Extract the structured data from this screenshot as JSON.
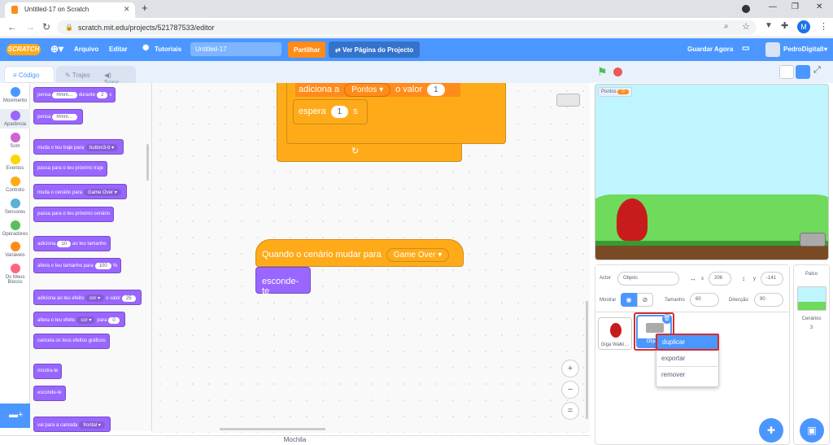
{
  "browser": {
    "tab_title": "Untitled-17 on Scratch",
    "url": "scratch.mit.edu/projects/521787533/editor",
    "profile_initial": "M"
  },
  "menu": {
    "logo": "SCRATCH",
    "file": "Arquivo",
    "edit": "Editar",
    "tutorials": "Tutoriais",
    "project_title": "Untitled-17",
    "share": "Partilhar",
    "see_project": "Ver Página do Projecto",
    "save_now": "Guardar Agora",
    "username": "PedroDigitalI"
  },
  "tabs": {
    "code": "Código",
    "costumes": "Trajes",
    "sounds": "Sons"
  },
  "categories": [
    {
      "label": "Movimento",
      "color": "#4c97ff"
    },
    {
      "label": "Aparência",
      "color": "#9966ff"
    },
    {
      "label": "Som",
      "color": "#cf63cf"
    },
    {
      "label": "Eventos",
      "color": "#ffd500"
    },
    {
      "label": "Controlo",
      "color": "#ffab19"
    },
    {
      "label": "Sensores",
      "color": "#5cb1d6"
    },
    {
      "label": "Operadores",
      "color": "#59c059"
    },
    {
      "label": "Variáveis",
      "color": "#ff8c1a"
    },
    {
      "label": "Os Meus Blocos",
      "color": "#ff6680"
    }
  ],
  "palette": {
    "think_for": "pensa",
    "hmm": "Hmm…",
    "during": "durante",
    "two": "2",
    "s": "s",
    "think": "pensa",
    "switch_costume": "muda o teu traje para",
    "costume_val": "button3-b",
    "next_costume": "passa para o teu próximo traje",
    "switch_backdrop": "muda o cenário para",
    "backdrop_val": "Game Over",
    "next_backdrop": "passa para o teu próximo cenário",
    "add_size": "adiciona",
    "ten": "10",
    "to_size": "ao teu tamanho",
    "set_size": "altera o teu tamanho para",
    "hundred": "100",
    "pct": "%",
    "add_effect": "adiciona ao teu efeito",
    "color": "cor",
    "value": "o valor",
    "twentyfive": "25",
    "set_effect": "altera o teu efeito",
    "to": "para",
    "zero": "0",
    "clear_effects": "cancela os teus efeitos gráficos",
    "show": "mostra-te",
    "hide": "esconde-te",
    "go_layer": "vai para a camada",
    "front": "frontal"
  },
  "workspace": {
    "top_add": "adiciona a",
    "top_var": "Pontos",
    "top_value": "o valor",
    "top_num": "1",
    "wait": "espera",
    "wait_num": "1",
    "wait_s": "s",
    "hat": "Quando o cenário mudar para",
    "hat_val": "Game Over",
    "hide": "esconde-te",
    "zoom_in": "+",
    "zoom_out": "−",
    "zoom_reset": "="
  },
  "stage": {
    "var_name": "Pontos",
    "var_value": "0"
  },
  "sprite_info": {
    "actor_label": "Actor",
    "actor_value": "Objeto",
    "x_label": "x",
    "x_value": "206",
    "y_label": "y",
    "y_value": "-141",
    "show_label": "Mostrar",
    "size_label": "Tamanho",
    "size_value": "60",
    "direction_label": "Direcção",
    "direction_value": "90"
  },
  "sprites": [
    {
      "name": "Giga Walki…"
    },
    {
      "name": "Obje…"
    }
  ],
  "stage_pane": {
    "title": "Palco",
    "backdrops_label": "Cenários",
    "backdrops_count": "3"
  },
  "context_menu": {
    "duplicate": "duplicar",
    "export": "exportar",
    "remove": "remover"
  },
  "footer": {
    "backpack": "Mochila"
  }
}
